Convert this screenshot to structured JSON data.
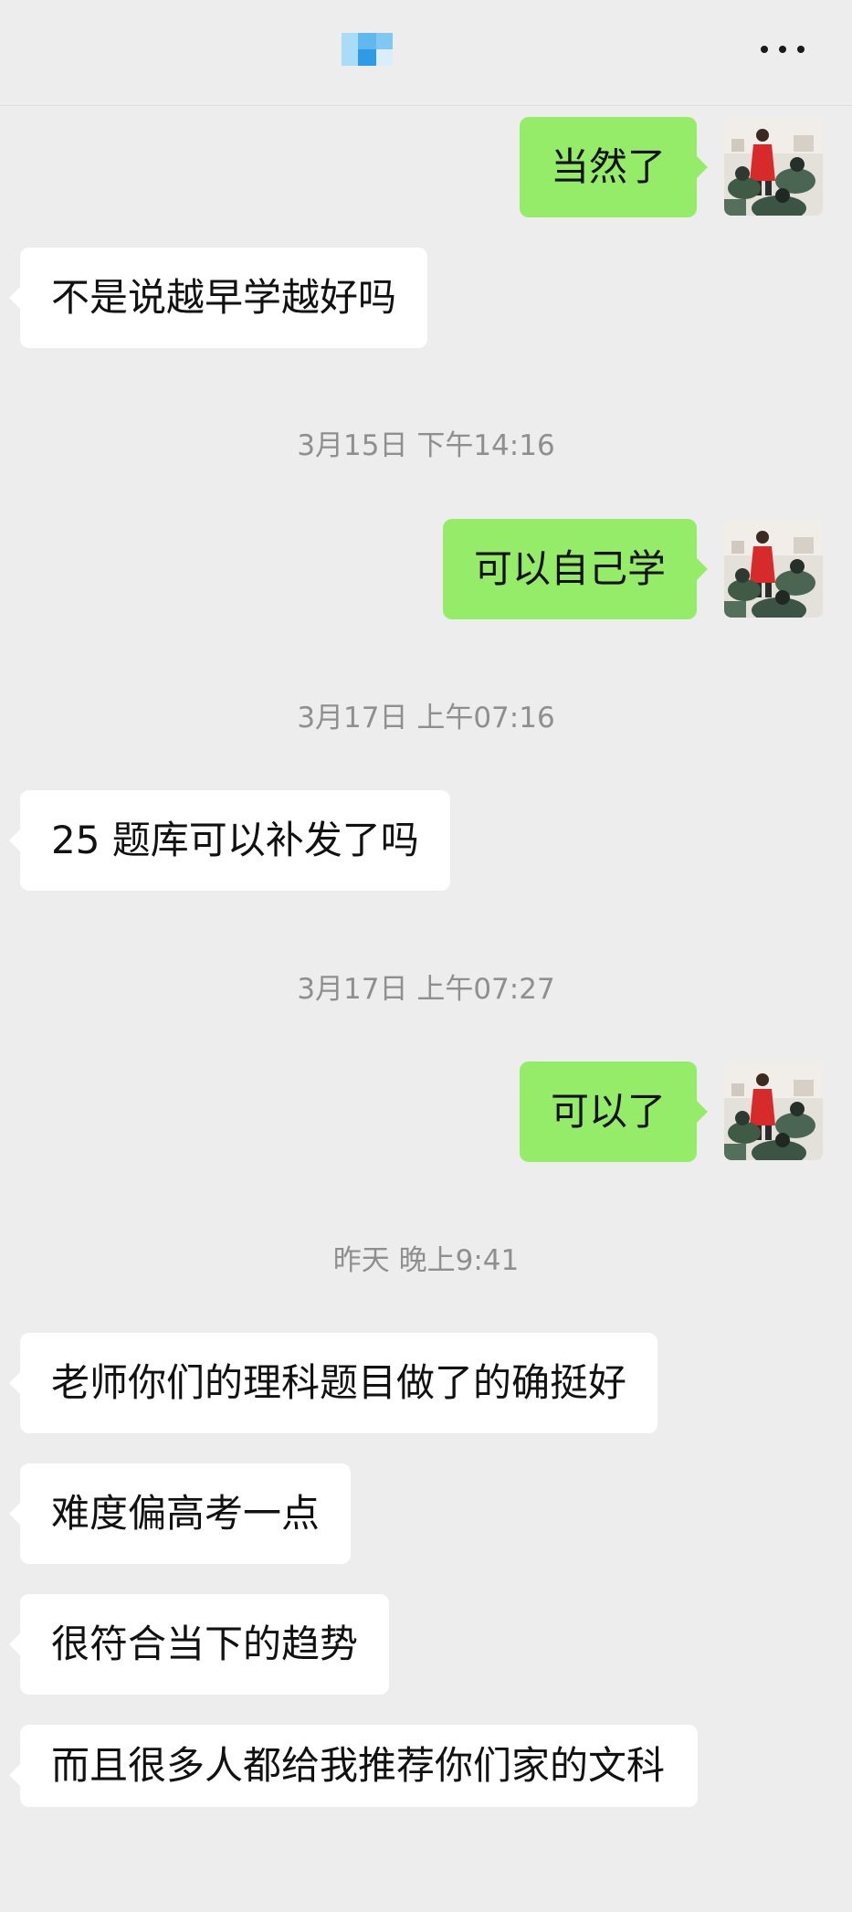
{
  "header": {
    "title_icon": "blurred-contact-name-mosaic",
    "more_icon": "more-dots-icon"
  },
  "messages": [
    {
      "side": "out",
      "text": "当然了"
    },
    {
      "side": "in",
      "text": "不是说越早学越好吗"
    },
    {
      "type": "time",
      "text": "3月15日 下午14:16"
    },
    {
      "side": "out",
      "text": "可以自己学"
    },
    {
      "type": "time",
      "text": "3月17日 上午07:16"
    },
    {
      "side": "in",
      "text": "25 题库可以补发了吗"
    },
    {
      "type": "time",
      "text": "3月17日 上午07:27"
    },
    {
      "side": "out",
      "text": "可以了"
    },
    {
      "type": "time",
      "text": "昨天 晚上9:41"
    },
    {
      "side": "in",
      "text": "老师你们的理科题目做了的确挺好"
    },
    {
      "side": "in",
      "text": "难度偏高考一点"
    },
    {
      "side": "in",
      "text": "很符合当下的趋势"
    },
    {
      "side": "in",
      "text": "而且很多人都给我推荐你们家的文科"
    }
  ],
  "colors": {
    "background": "#ededed",
    "outgoing_bubble": "#95ec69",
    "incoming_bubble": "#ffffff",
    "timestamp_text": "#8f8f8f"
  }
}
